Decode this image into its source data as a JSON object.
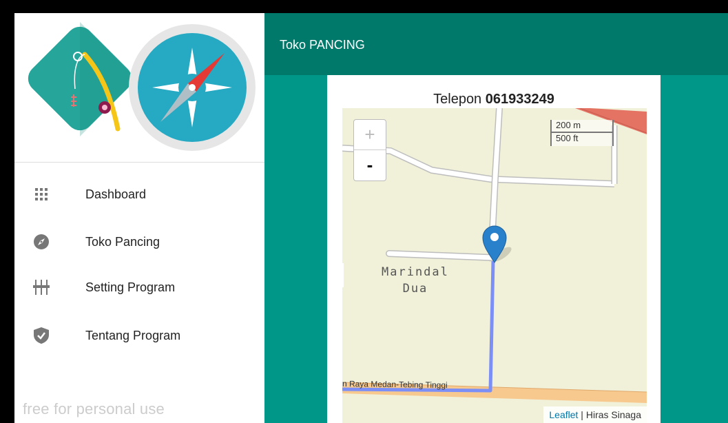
{
  "app": {
    "title": "Toko PANCING"
  },
  "sidebar": {
    "items": [
      {
        "label": "Dashboard",
        "icon": "grid-icon"
      },
      {
        "label": "Toko Pancing",
        "icon": "compass-icon"
      },
      {
        "label": "Setting Program",
        "icon": "sliders-icon"
      },
      {
        "label": "Tentang Program",
        "icon": "shield-check-icon"
      }
    ],
    "watermark": "free for personal use"
  },
  "card": {
    "phone_label": "Telepon",
    "phone_number": "061933249"
  },
  "map": {
    "zoom_in": "+",
    "zoom_out": "-",
    "scale_metric": "200 m",
    "scale_imperial": "500 ft",
    "place": "Marindal\nDua",
    "place_line1": "Marindal",
    "place_line2": "Dua",
    "road": "n Raya Medan-Tebing Tinggi",
    "attribution_link": "Leaflet",
    "attribution_sep": " | ",
    "attribution_text": "Hiras Sinaga"
  },
  "colors": {
    "appbar": "#00796b",
    "main_background": "#009688",
    "logo_teal": "#26a69a",
    "compass_blue": "#26a9c2",
    "route": "#7b8ff7",
    "marker": "#2a81cb"
  }
}
